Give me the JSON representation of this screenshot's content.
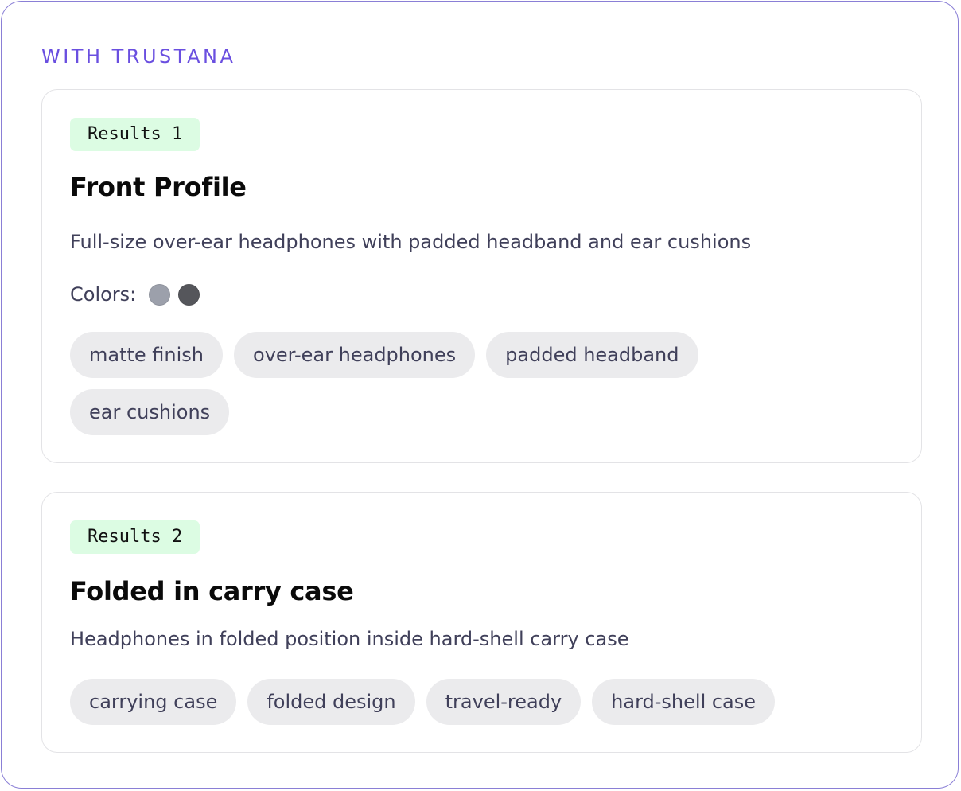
{
  "panel": {
    "heading": "WITH TRUSTANA",
    "accent_color": "#6a4fe0",
    "border_color": "#8a7fd6"
  },
  "results": [
    {
      "badge": "Results 1",
      "title": "Front Profile",
      "description": "Full-size over-ear headphones with padded headband and ear cushions",
      "colors_label": "Colors:",
      "colors": [
        "#9ca0ab",
        "#55565b"
      ],
      "tags": [
        "matte finish",
        "over-ear headphones",
        "padded headband",
        "ear cushions"
      ]
    },
    {
      "badge": "Results 2",
      "title": "Folded in carry case",
      "description": "Headphones in folded position inside hard-shell carry case",
      "tags": [
        "carrying case",
        "folded design",
        "travel-ready",
        "hard-shell case"
      ]
    }
  ],
  "badge_color": "#dcfce3",
  "tag_color": "#ebebed"
}
